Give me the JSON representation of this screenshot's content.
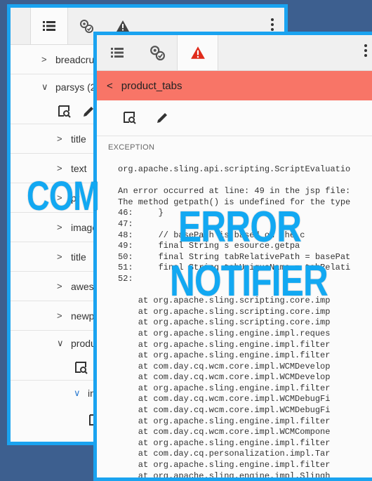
{
  "colors": {
    "background": "#3d5f8f",
    "frame": "#1aa3f0",
    "error_bar": "#f87567",
    "headline": "#12a8f2",
    "warning_icon": "#e02b1b"
  },
  "back_panel": {
    "tabs": [
      {
        "icon": "list-icon"
      },
      {
        "icon": "component-status-icon"
      },
      {
        "icon": "warning-icon"
      }
    ],
    "tree": [
      {
        "label": "breadcrum",
        "chevron": ">",
        "indent": 0
      },
      {
        "label": "parsys (2",
        "chevron": "v",
        "indent": 0
      },
      {
        "label": "title",
        "chevron": ">",
        "indent": 1
      },
      {
        "label": "text",
        "chevron": ">",
        "indent": 1
      },
      {
        "label": "pr",
        "chevron": ">",
        "indent": 1
      },
      {
        "label": "image",
        "chevron": ">",
        "indent": 1
      },
      {
        "label": "title",
        "chevron": ">",
        "indent": 1
      },
      {
        "label": "aweso",
        "chevron": ">",
        "indent": 1
      },
      {
        "label": "newpa",
        "chevron": ">",
        "indent": 1
      },
      {
        "label": "produ",
        "chevron": "v",
        "indent": 1
      },
      {
        "label": "in",
        "chevron": "v",
        "indent": 2
      }
    ]
  },
  "front_panel": {
    "tabs": [
      {
        "icon": "list-icon"
      },
      {
        "icon": "component-status-icon"
      },
      {
        "icon": "warning-icon"
      }
    ],
    "error_bar": {
      "title": "product_tabs"
    },
    "section_label": "EXCEPTION",
    "code_lines": [
      "org.apache.sling.api.scripting.ScriptEvaluatio",
      "",
      "An error occurred at line: 49 in the jsp file:",
      "The method getpath() is undefined for the type",
      "46:     }",
      "47:",
      "48:     // basePath is based on the c",
      "49:     final String s esource.getpa",
      "50:     final String tabRelativePath = basePat",
      "51:     final String tabUniqueName = tabRelati",
      "52:",
      "",
      "    at org.apache.sling.scripting.core.imp",
      "    at org.apache.sling.scripting.core.imp",
      "    at org.apache.sling.scripting.core.imp",
      "    at org.apache.sling.engine.impl.reques",
      "    at org.apache.sling.engine.impl.filter",
      "    at org.apache.sling.engine.impl.filter",
      "    at com.day.cq.wcm.core.impl.WCMDevelop",
      "    at com.day.cq.wcm.core.impl.WCMDevelop",
      "    at org.apache.sling.engine.impl.filter",
      "    at com.day.cq.wcm.core.impl.WCMDebugFi",
      "    at com.day.cq.wcm.core.impl.WCMDebugFi",
      "    at org.apache.sling.engine.impl.filter",
      "    at com.day.cq.wcm.core.impl.WCMCompone",
      "    at org.apache.sling.engine.impl.filter",
      "    at com.day.cq.personalization.impl.Tar",
      "    at org.apache.sling.engine.impl.filter",
      "    at org.apache.sling.engine.impl.Slingh"
    ]
  },
  "overlay": {
    "line1": "COM",
    "line2": "ERROR",
    "line3": "NOTIFIER"
  }
}
